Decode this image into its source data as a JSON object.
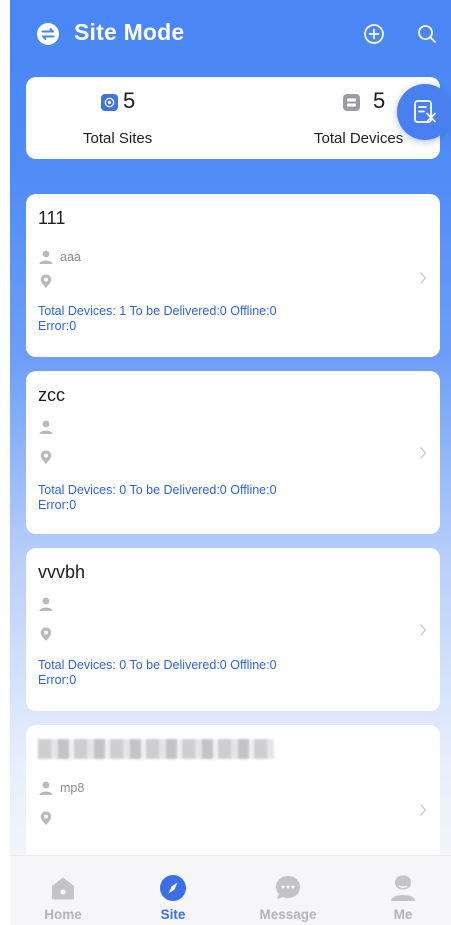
{
  "header": {
    "title": "Site Mode",
    "switch_icon": "switch-arrows-icon",
    "add_icon": "plus-circle-icon",
    "search_icon": "search-icon"
  },
  "summary": {
    "total_sites_count": "5",
    "total_sites_label": "Total Sites",
    "total_devices_count": "5",
    "total_devices_label": "Total Devices"
  },
  "fab": {
    "icon": "list-history-icon"
  },
  "sites": [
    {
      "name": "111",
      "owner": "aaa",
      "location": "",
      "stats_line1": "Total Devices: 1 To be Delivered:0 Offline:0",
      "stats_line2": "Error:0"
    },
    {
      "name": "zcc",
      "owner": "",
      "location": "",
      "stats_line1": "Total Devices: 0 To be Delivered:0 Offline:0",
      "stats_line2": "Error:0"
    },
    {
      "name": "vvvbh",
      "owner": "",
      "location": "",
      "stats_line1": "Total Devices: 0 To be Delivered:0 Offline:0",
      "stats_line2": "Error:0"
    },
    {
      "name": "",
      "owner": "mp8",
      "location": ""
    }
  ],
  "nav": {
    "items": [
      {
        "label": "Home",
        "icon": "home-icon"
      },
      {
        "label": "Site",
        "icon": "compass-icon"
      },
      {
        "label": "Message",
        "icon": "chat-bubble-icon"
      },
      {
        "label": "Me",
        "icon": "user-icon"
      }
    ],
    "active": "Site"
  },
  "colors": {
    "primary": "#4a86f4",
    "stats_text": "#2e64d6",
    "nav_active": "#3b6fe6",
    "nav_inactive": "#b4b4b8"
  }
}
